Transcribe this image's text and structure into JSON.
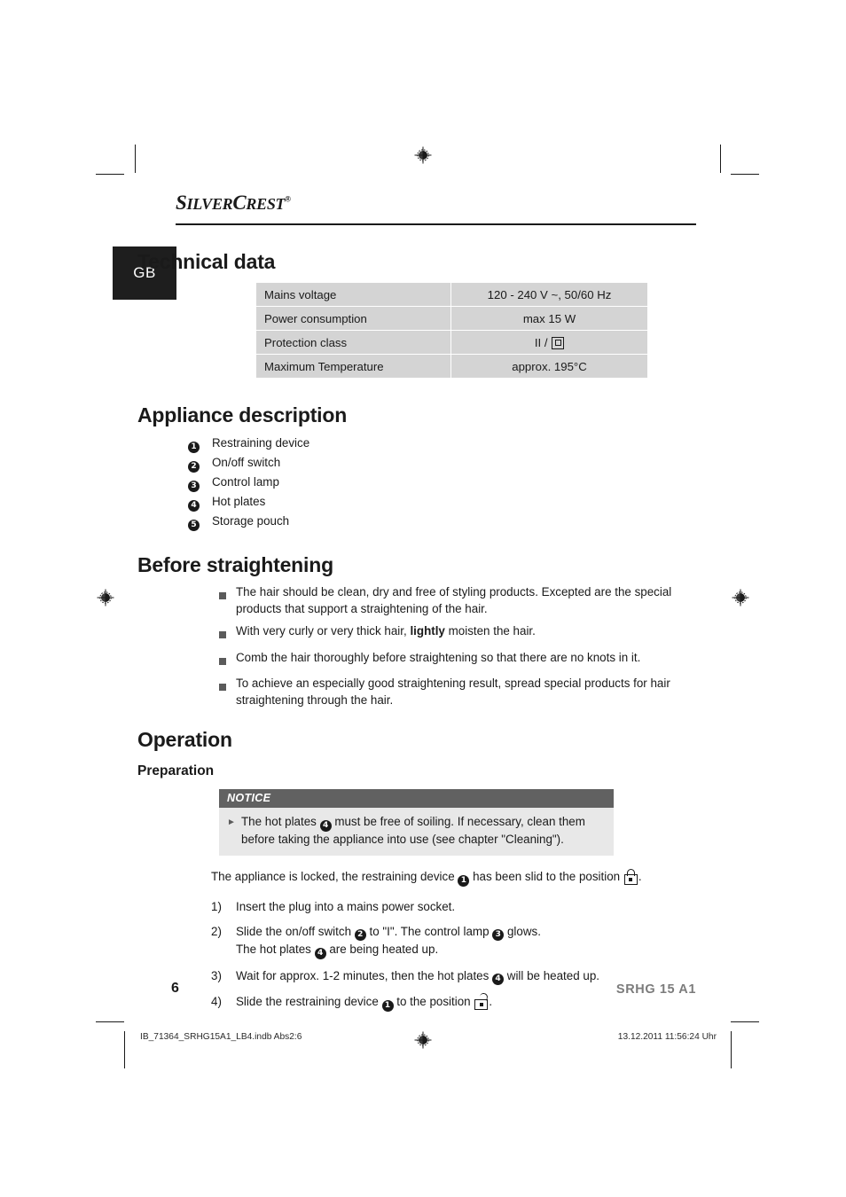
{
  "brand": {
    "name_first": "S",
    "name_rest": "ILVER",
    "name_second": "C",
    "name_rest2": "REST",
    "registered_mark": "®"
  },
  "language_tab": {
    "label": "GB"
  },
  "technical_data": {
    "heading": "Technical data",
    "rows": [
      {
        "key": "Mains voltage",
        "value": "120 - 240 V ~, 50/60 Hz",
        "symbol": ""
      },
      {
        "key": "Power consumption",
        "value": "max 15 W",
        "symbol": ""
      },
      {
        "key": "Protection class",
        "value": "II / ",
        "symbol": "class-II-double-insulation"
      },
      {
        "key": "Maximum Temperature",
        "value": "approx. 195°C",
        "symbol": ""
      }
    ]
  },
  "appliance_description": {
    "heading": "Appliance description",
    "items": [
      {
        "num": "1",
        "label": "Restraining device"
      },
      {
        "num": "2",
        "label": "On/off switch"
      },
      {
        "num": "3",
        "label": "Control lamp"
      },
      {
        "num": "4",
        "label": "Hot plates"
      },
      {
        "num": "5",
        "label": "Storage pouch"
      }
    ]
  },
  "before_straightening": {
    "heading": "Before straightening",
    "bullets": [
      {
        "text_before": "The hair should be clean, dry and free of styling products. Excepted are the special products that support a straightening of the hair.",
        "bold": "",
        "text_after": ""
      },
      {
        "text_before": "With very curly or very thick hair, ",
        "bold": "lightly",
        "text_after": " moisten the hair."
      },
      {
        "text_before": "Comb the hair thoroughly before straightening so that there are no knots in it.",
        "bold": "",
        "text_after": ""
      },
      {
        "text_before": "To achieve an especially good straightening result, spread special products for hair straightening through the hair.",
        "bold": "",
        "text_after": ""
      }
    ]
  },
  "operation": {
    "heading": "Operation",
    "subheading": "Preparation",
    "notice": {
      "title": "NOTICE",
      "arrow": "►",
      "text_before": "The hot plates ",
      "ref_num": "4",
      "text_after": " must be free of soiling. If necessary, clean them before taking the appliance into use (see chapter \"Cleaning\")."
    },
    "lead": {
      "text_before": "The appliance is locked, the restraining device ",
      "ref_num": "1",
      "text_mid": " has been slid to the position ",
      "lock_icon": "padlock-closed-icon",
      "text_after": "."
    },
    "steps": [
      {
        "index": "1)",
        "parts": [
          {
            "t": "Insert the plug into a mains power socket."
          }
        ]
      },
      {
        "index": "2)",
        "parts": [
          {
            "t": "Slide the on/off switch "
          },
          {
            "ref": "2"
          },
          {
            "t": " to \"I\". The control lamp "
          },
          {
            "ref": "3"
          },
          {
            "t": " glows."
          },
          {
            "br": true
          },
          {
            "t": "The hot plates "
          },
          {
            "ref": "4"
          },
          {
            "t": " are being heated up."
          }
        ]
      },
      {
        "index": "3)",
        "parts": [
          {
            "t": "Wait for approx. 1-2 minutes, then the hot plates "
          },
          {
            "ref": "4"
          },
          {
            "t": " will be heated up."
          }
        ]
      },
      {
        "index": "4)",
        "parts": [
          {
            "t": "Slide the restraining device "
          },
          {
            "ref": "1"
          },
          {
            "t": " to the position "
          },
          {
            "lock": "open"
          },
          {
            "t": "."
          }
        ]
      }
    ]
  },
  "footer": {
    "page_number": "6",
    "model": "SRHG 15 A1",
    "imprint_file": "IB_71364_SRHG15A1_LB4.indb   Abs2:6",
    "imprint_date": "13.12.2011   11:56:24 Uhr"
  },
  "colors": {
    "table_cell": "#d4d4d4",
    "notice_header": "#616161",
    "notice_body": "#e8e8e8",
    "lang_tab": "#1e1e1e",
    "model_text": "#7c7c7c",
    "bullet_square": "#5b5b5b"
  }
}
